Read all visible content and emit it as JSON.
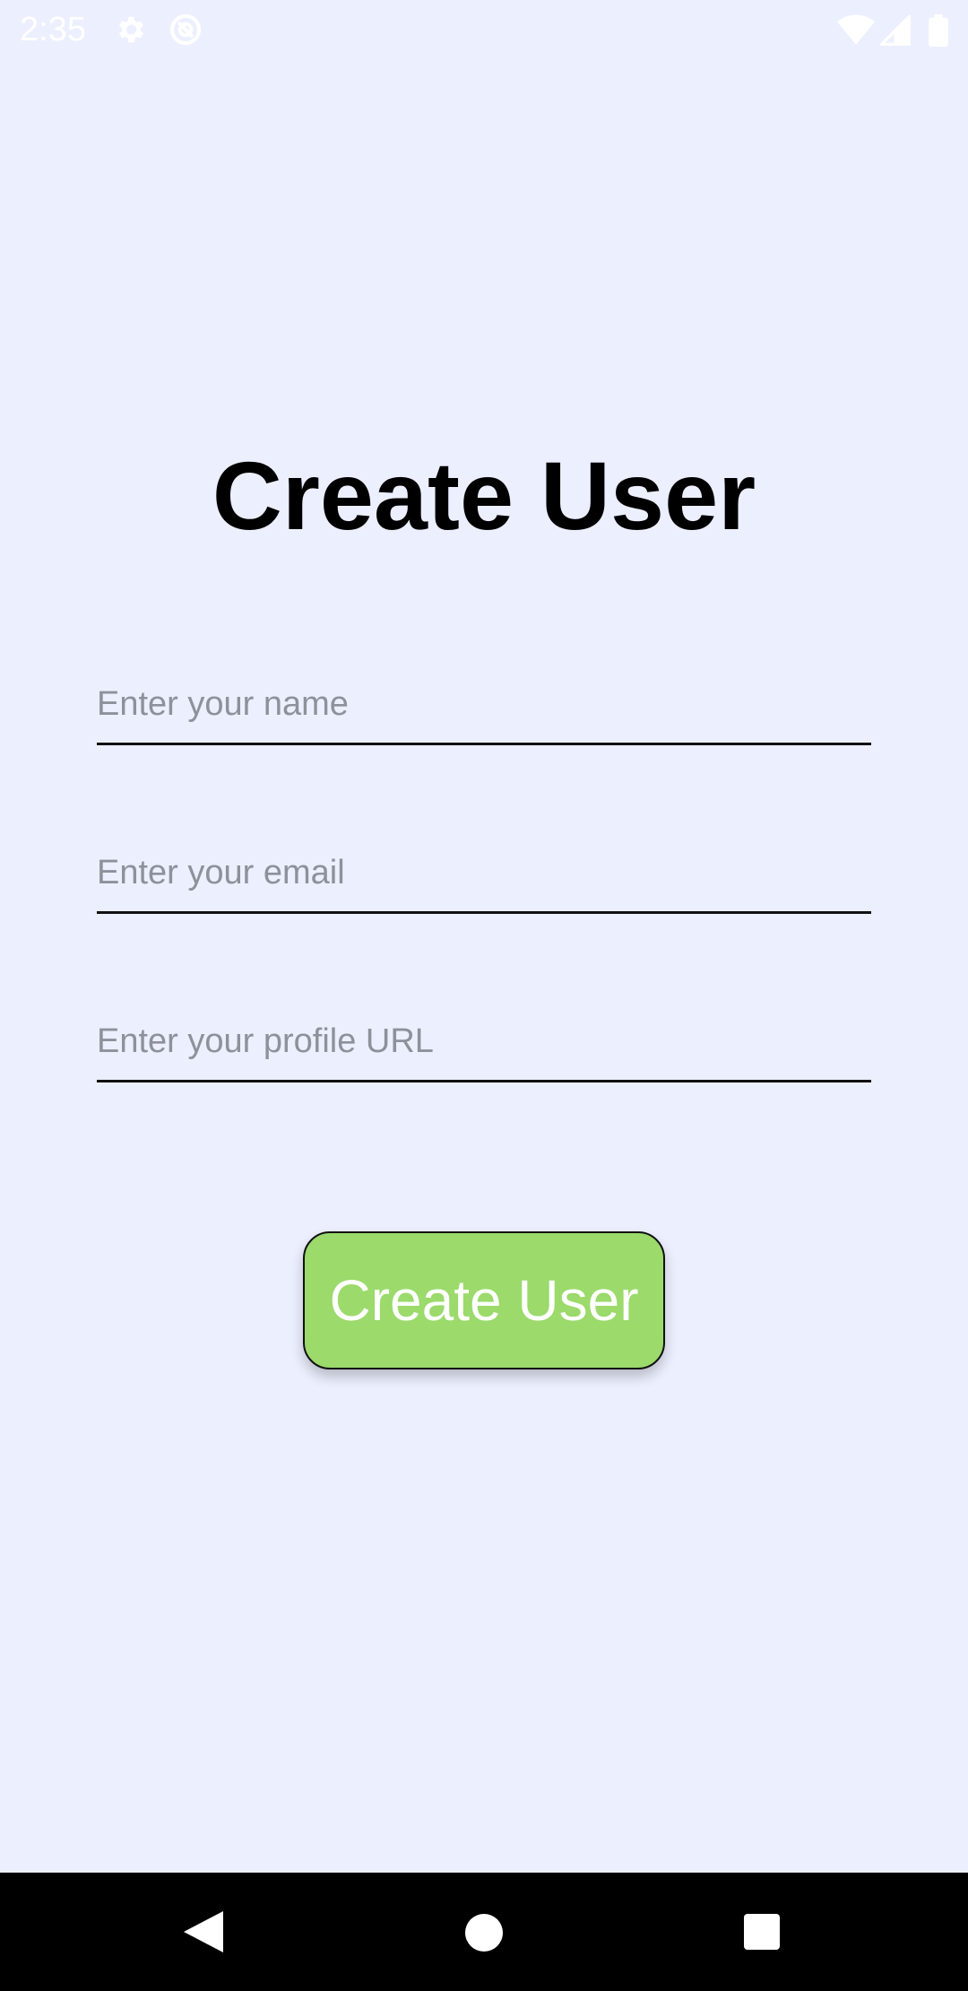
{
  "status_bar": {
    "time": "2:35",
    "icons_left": [
      "gear-icon",
      "at-sign-icon"
    ],
    "icons_right": [
      "wifi-icon",
      "cellular-signal-icon",
      "battery-icon"
    ]
  },
  "form": {
    "title": "Create User",
    "name_placeholder": "Enter your name",
    "email_placeholder": "Enter your email",
    "profile_url_placeholder": "Enter your profile URL",
    "submit_label": "Create User"
  },
  "nav_bar": {
    "icons": [
      "back-triangle-icon",
      "home-circle-icon",
      "recents-square-icon"
    ]
  },
  "colors": {
    "background": "#ECEFFE",
    "button": "#9BDA6B",
    "title": "#000000",
    "placeholder": "#8D9199"
  }
}
